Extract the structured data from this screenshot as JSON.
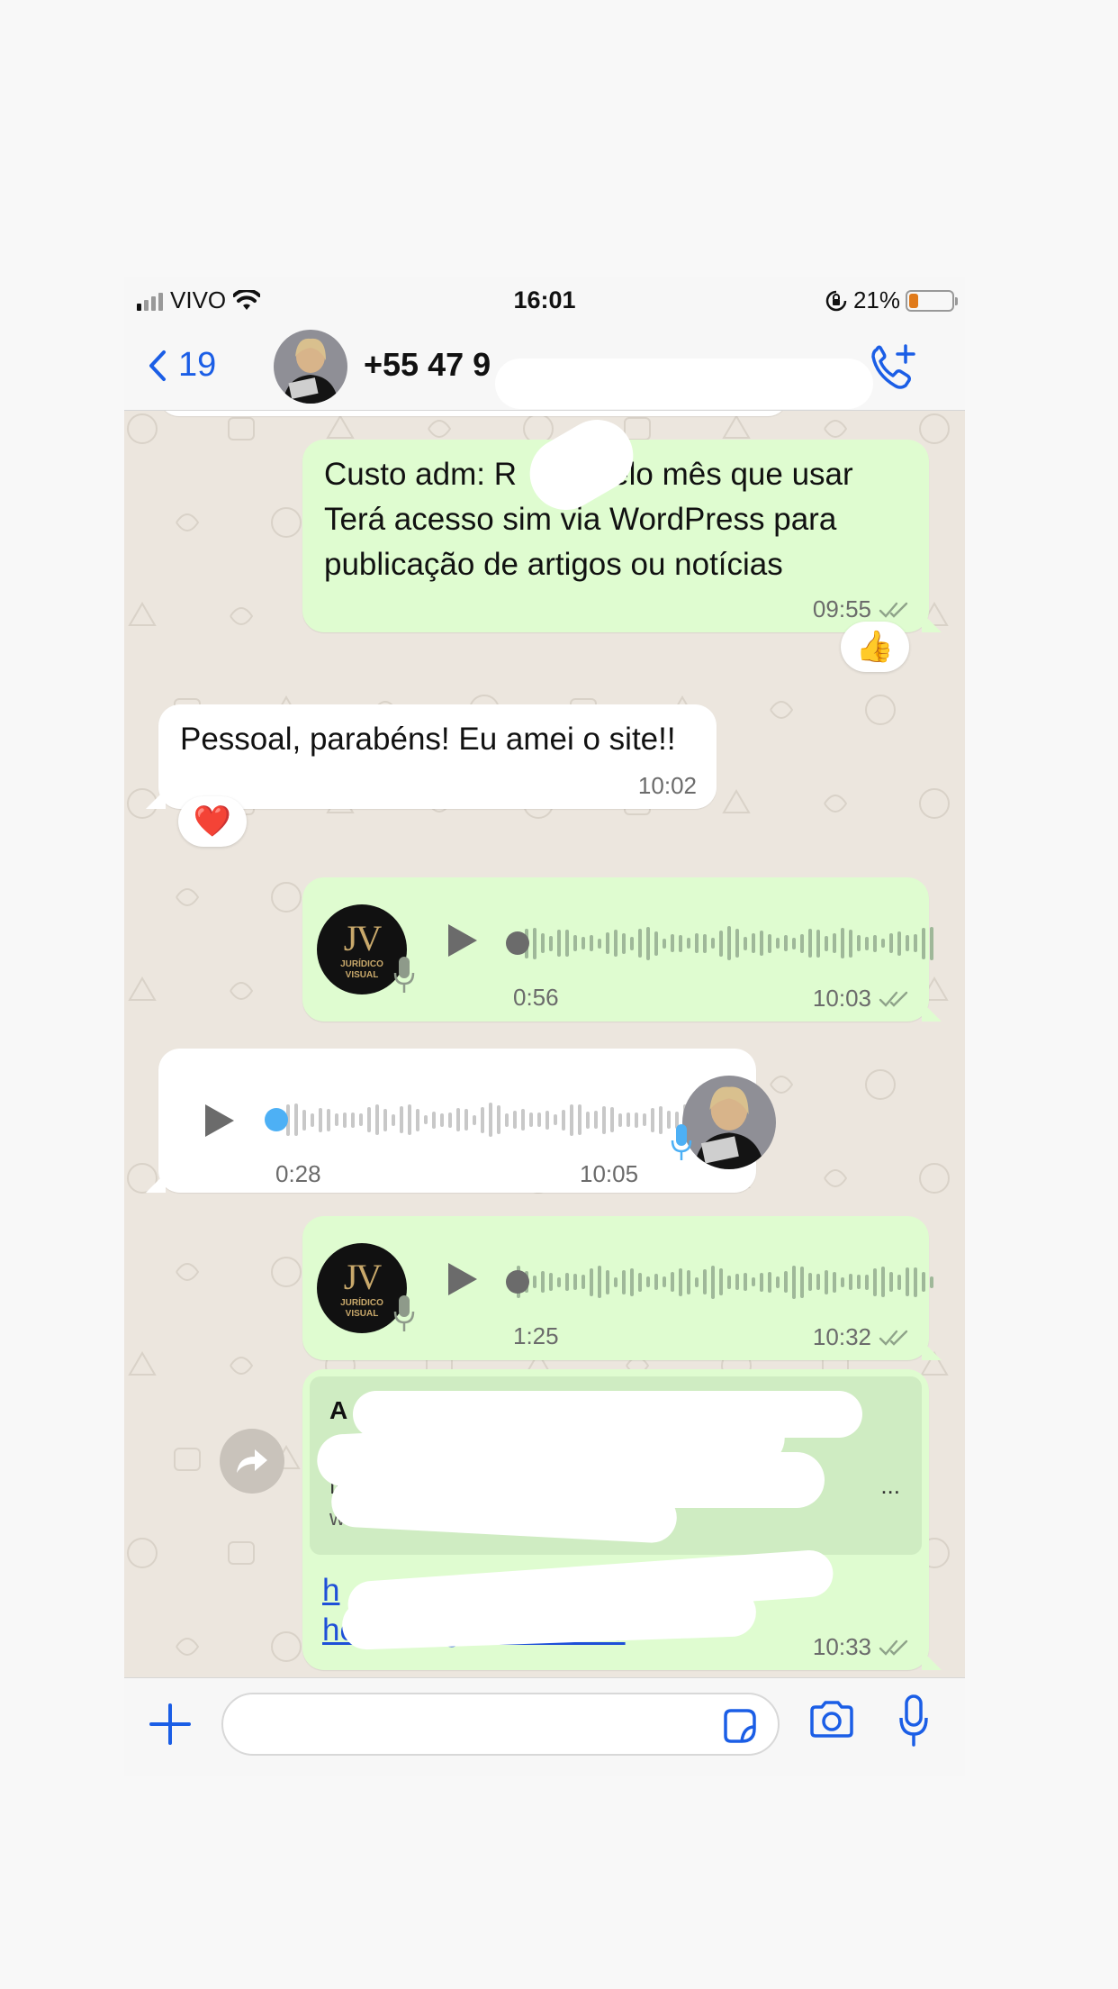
{
  "status_bar": {
    "carrier": "VIVO",
    "time": "16:01",
    "battery": "21%",
    "battery_level": 0.21
  },
  "header": {
    "back_count": "19",
    "contact": "+55 47 9"
  },
  "messages": {
    "m1": {
      "text_parts": [
        "Custo adm: R",
        "pelo mês que usar",
        "Terá acesso sim via WordPress para",
        "publicação de artigos ou notícias"
      ],
      "time": "09:55",
      "reaction": "👍"
    },
    "m2": {
      "text": "Pessoal, parabéns! Eu amei o site!!",
      "time": "10:02",
      "reaction": "❤️"
    },
    "m3": {
      "duration": "0:56",
      "time": "10:03"
    },
    "m4": {
      "duration": "0:28",
      "time": "10:05"
    },
    "m5": {
      "duration": "1:25",
      "time": "10:32"
    },
    "m6": {
      "preview_title_start": "A r",
      "preview_desc_start": "N",
      "preview_desc_end": "...",
      "preview_host_start": "w",
      "link_start": "h",
      "link_end": "hospedagem-de-sites",
      "time": "10:33"
    }
  },
  "logo": {
    "initials": "JV",
    "line1": "JURÍDICO",
    "line2": "VISUAL"
  },
  "colors": {
    "accent": "#1b5ee6",
    "outgoing": "#dffcd0",
    "incoming": "#ffffff",
    "chat_bg": "#ece6de",
    "unread_dot": "#4db0f5"
  }
}
